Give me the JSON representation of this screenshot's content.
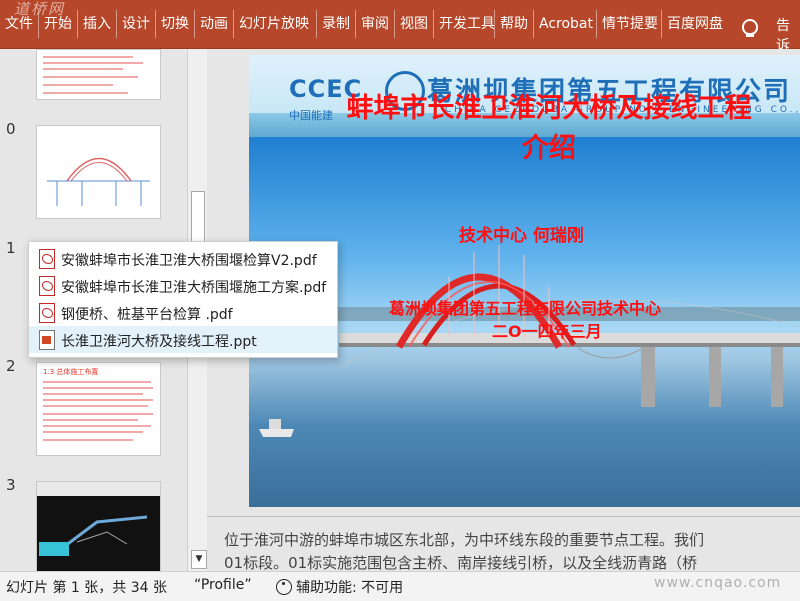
{
  "ribbon": {
    "watermark": "道桥网",
    "tabs": [
      "文件",
      "开始",
      "插入",
      "设计",
      "切换",
      "动画",
      "幻灯片放映",
      "录制",
      "审阅",
      "视图",
      "开发工具",
      "帮助",
      "Acrobat",
      "情节提要",
      "百度网盘"
    ],
    "tell_me": "告诉"
  },
  "thumbnails": [
    {
      "number": "",
      "title": ""
    },
    {
      "number": "0",
      "title": ""
    },
    {
      "number": "1",
      "title": ""
    },
    {
      "number": "2",
      "title": "1.3 总体施工布置"
    },
    {
      "number": "3",
      "title": ""
    }
  ],
  "popup": {
    "items": [
      {
        "label": "安徽蚌埠市长淮卫淮大桥围堰检算V2.pdf",
        "type": "pdf"
      },
      {
        "label": "安徽蚌埠市长淮卫淮大桥围堰施工方案.pdf",
        "type": "pdf"
      },
      {
        "label": "钢便桥、桩基平台检算 .pdf",
        "type": "pdf"
      },
      {
        "label": "长淮卫淮河大桥及接线工程.ppt",
        "type": "ppt",
        "selected": true
      }
    ]
  },
  "slide": {
    "logo_ccec": "CCEC",
    "logo_sub": "中国能建",
    "company": "葛洲坝集团第五工程有限公司",
    "company_en": "CHINA GEZHOUBA GROUP NO.5 ENGINEERING CO.,LTD",
    "title_line1": "蚌埠市长淮卫淮河大桥及接线工程",
    "title_line2": "介绍",
    "tech_center": "技术中心  何瑞刚",
    "company_line": "葛洲坝集团第五工程有限公司技术中心",
    "date_line": "二O一四年三月"
  },
  "notes": {
    "line1": "位于淮河中游的蚌埠市城区东北部，为中环线东段的重要节点工程。我们",
    "line2": "01标段。01标实施范围包含主桥、南岸接线引桥，以及全线沥青路（桥"
  },
  "status": {
    "slide_count": "幻灯片 第 1 张，共 34 张",
    "theme": "“Profile”",
    "accessibility": "辅助功能: 不可用",
    "watermark": "www.cnqao.com"
  },
  "colors": {
    "ribbon": "#b7472a",
    "title_red": "#ff1010",
    "company_blue": "#1f6fb8"
  }
}
